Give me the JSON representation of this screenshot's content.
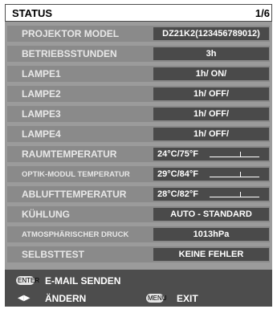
{
  "header": {
    "title": "STATUS",
    "page": "1/6"
  },
  "rows": [
    {
      "label": "PROJEKTOR MODEL",
      "value": "DZ21K2(123456789012)"
    },
    {
      "label": "BETRIEBSSTUNDEN",
      "value": "3h"
    },
    {
      "label": "LAMPE1",
      "value": "1h/ ON/"
    },
    {
      "label": "LAMPE2",
      "value": "1h/ OFF/"
    },
    {
      "label": "LAMPE3",
      "value": "1h/ OFF/"
    },
    {
      "label": "LAMPE4",
      "value": "1h/ OFF/"
    },
    {
      "label": "RAUMTEMPERATUR",
      "value": "24°C/75°F",
      "level": 0.6
    },
    {
      "label": "OPTIK-MODUL TEMPERATUR",
      "value": "29°C/84°F",
      "level": 0.6
    },
    {
      "label": "ABLUFTTEMPERATUR",
      "value": "28°C/82°F",
      "level": 0.6
    },
    {
      "label": "KÜHLUNG",
      "value": "AUTO - STANDARD"
    },
    {
      "label": "ATMOSPHÄRISCHER DRUCK",
      "value": "1013hPa"
    },
    {
      "label": "SELBSTTEST",
      "value": "KEINE FEHLER"
    }
  ],
  "footer": {
    "enter_key": "ENTER",
    "email_label": "E-MAIL SENDEN",
    "change_label": "ÄNDERN",
    "menu_key": "MENU",
    "exit_label": "EXIT"
  }
}
